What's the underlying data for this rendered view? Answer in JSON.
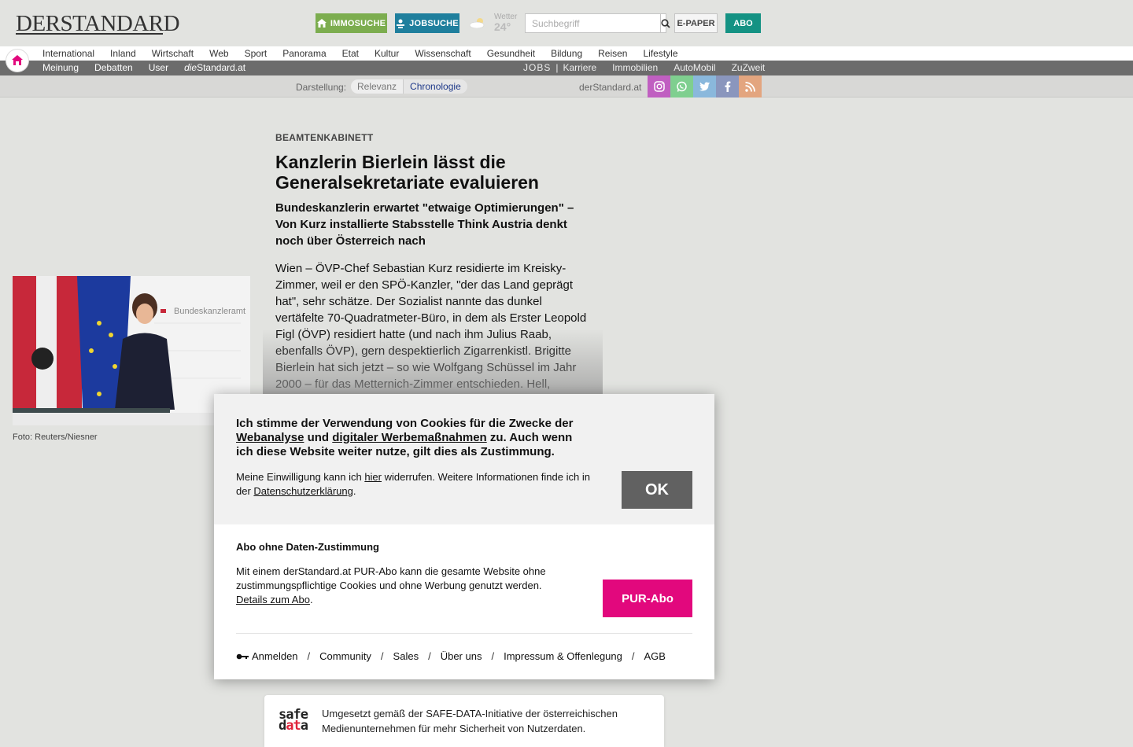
{
  "header": {
    "logo": "DERSTANDARD",
    "immo_label": "IMMOSUCHE",
    "jobs_label": "JOBSUCHE",
    "weather_label": "Wetter",
    "weather_temp": "24°",
    "search_placeholder": "Suchbegriff",
    "epaper_label": "E-PAPER",
    "abo_label": "ABO"
  },
  "nav_main": [
    "International",
    "Inland",
    "Wirtschaft",
    "Web",
    "Sport",
    "Panorama",
    "Etat",
    "Kultur",
    "Wissenschaft",
    "Gesundheit",
    "Bildung",
    "Reisen",
    "Lifestyle"
  ],
  "nav_sub_left": [
    "Meinung",
    "Debatten",
    "User"
  ],
  "nav_sub_brand_prefix": "die",
  "nav_sub_brand": "Standard.at",
  "nav_sub_right": {
    "jobs": "JOBS",
    "sep": "|",
    "items": [
      "Karriere",
      "Immobilien",
      "AutoMobil",
      "ZuZweit"
    ]
  },
  "display_bar": {
    "label": "Darstellung:",
    "options": [
      "Relevanz",
      "Chronologie"
    ],
    "selected": "Chronologie",
    "site": "derStandard.at"
  },
  "social": [
    {
      "icon": "instagram-icon",
      "color": "#c05fc1"
    },
    {
      "icon": "whatsapp-icon",
      "color": "#7fcf8f"
    },
    {
      "icon": "twitter-icon",
      "color": "#8ab8dc"
    },
    {
      "icon": "facebook-icon",
      "color": "#8a96bd"
    },
    {
      "icon": "rss-icon",
      "color": "#e3a57f"
    }
  ],
  "article": {
    "kicker": "BEAMTENKABINETT",
    "headline": "Kanzlerin Bierlein lässt die Generalsekretariate evaluieren",
    "lead": "Bundeskanzlerin erwartet \"etwaige Optimierungen\" – Von Kurz installierte Stabsstelle Think Austria denkt noch über Österreich nach",
    "body": "Wien – ÖVP-Chef Sebastian Kurz residierte im Kreisky-Zimmer, weil er den SPÖ-Kanzler, \"der das Land geprägt hat\", sehr schätze. Der Sozialist nannte das dunkel vertäfelte 70-Quadratmeter-Büro, in dem als Erster Leopold Figl (ÖVP) residiert hatte (und nach ihm Julius Raab, ebenfalls ÖVP), gern despektierlich Zigarrenkistl. Brigitte Bierlein hat sich jetzt – so wie Wolfgang Schüssel im Jahr 2000 – für das Metternich-Zimmer entschieden. Hell,",
    "photo_text": "Bundeskanzleramt",
    "caption": "Foto: Reuters/Niesner"
  },
  "cookie": {
    "title_a": "Ich stimme der Verwendung von Cookies für die Zwecke der ",
    "title_link1": "Webanalyse",
    "title_b": " und ",
    "title_link2": "digitaler Werbemaßnahmen",
    "title_c": " zu. Auch wenn ich diese Website weiter nutze, gilt dies als Zustimmung.",
    "sub_a": "Meine Einwilligung kann ich ",
    "sub_link1": "hier",
    "sub_b": " widerrufen. Weitere Informationen finde ich in der ",
    "sub_link2": "Datenschutzerklärung",
    "sub_c": ".",
    "ok_label": "OK",
    "abo_head": "Abo ohne Daten-Zustimmung",
    "abo_text": "Mit einem derStandard.at PUR-Abo kann die gesamte Website ohne zustimmungspflichtige Cookies und ohne Werbung genutzt werden.",
    "abo_link": "Details zum Abo",
    "abo_dot": ".",
    "pur_label": "PUR-Abo",
    "footer": [
      "Anmelden",
      "Community",
      "Sales",
      "Über uns",
      "Impressum & Offenlegung",
      "AGB"
    ],
    "footer_sep": "/"
  },
  "safedata": {
    "logo_top": "safe",
    "logo_bottom_a": "d",
    "logo_bottom_b": "at",
    "logo_bottom_c": "a",
    "text": "Umgesetzt gemäß der SAFE-DATA-Initiative der österreichischen Medienunternehmen für mehr Sicherheit von Nutzerdaten."
  }
}
